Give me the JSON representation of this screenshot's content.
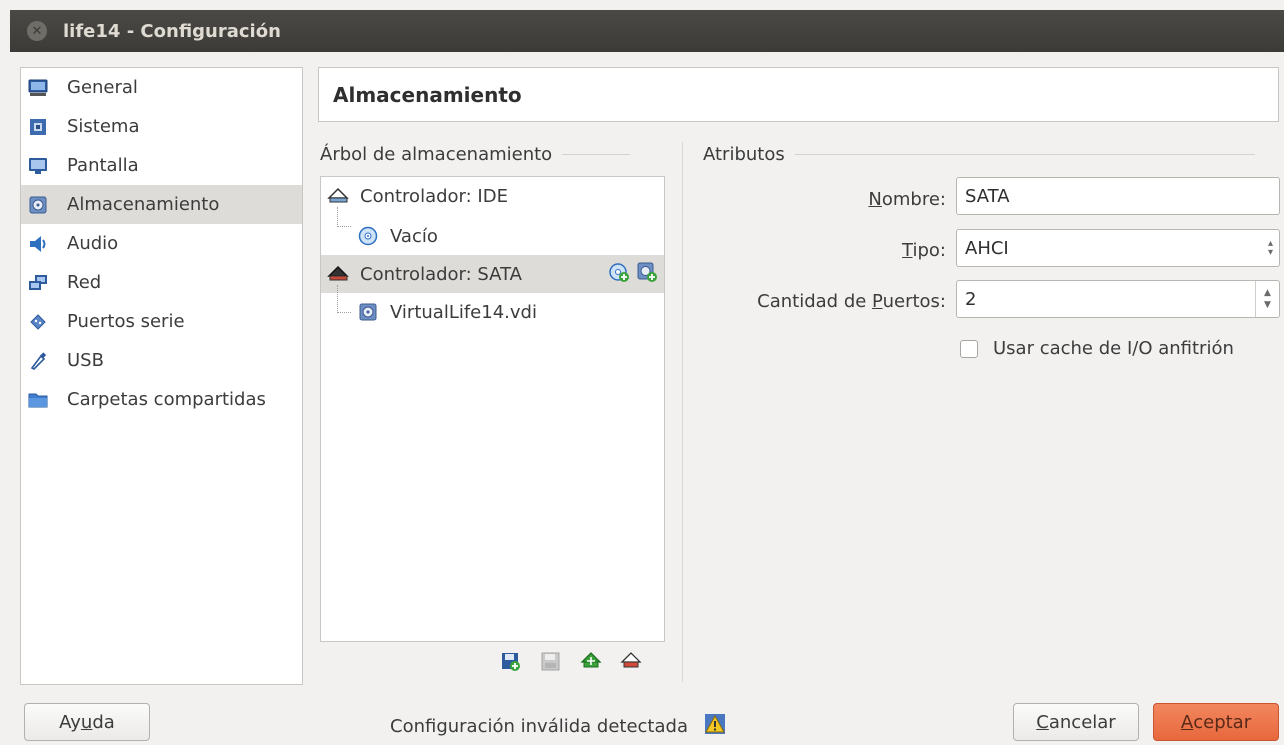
{
  "window": {
    "title": "life14 - Configuración",
    "close_glyph": "✕"
  },
  "sidebar": {
    "items": [
      {
        "label": "General",
        "icon": "monitor-icon"
      },
      {
        "label": "Sistema",
        "icon": "chip-icon"
      },
      {
        "label": "Pantalla",
        "icon": "display-icon"
      },
      {
        "label": "Almacenamiento",
        "icon": "hard-disk-icon",
        "selected": true
      },
      {
        "label": "Audio",
        "icon": "speaker-icon"
      },
      {
        "label": "Red",
        "icon": "network-icon"
      },
      {
        "label": "Puertos serie",
        "icon": "serial-port-icon"
      },
      {
        "label": "USB",
        "icon": "usb-icon"
      },
      {
        "label": "Carpetas compartidas",
        "icon": "folder-icon"
      }
    ]
  },
  "header": {
    "title": "Almacenamiento"
  },
  "storage_tree": {
    "title": "Árbol de almacenamiento",
    "nodes": [
      {
        "label": "Controlador: IDE",
        "icon": "ide-controller-icon"
      },
      {
        "label": "Vacío",
        "icon": "optical-disc-icon"
      },
      {
        "label": "Controlador: SATA",
        "icon": "sata-controller-icon",
        "selected": true
      },
      {
        "label": "VirtualLife14.vdi",
        "icon": "hard-disk-icon"
      }
    ],
    "toolbar": [
      "add-attachment-icon",
      "remove-attachment-icon",
      "add-controller-icon",
      "remove-controller-icon"
    ]
  },
  "attributes": {
    "title": "Atributos",
    "name_label_pre": "",
    "name_label_u": "N",
    "name_label_post": "ombre:",
    "name_value": "SATA",
    "type_label_u": "T",
    "type_label_post": "ipo:",
    "type_value": "AHCI",
    "ports_label_pre": "Cantidad de ",
    "ports_label_u": "P",
    "ports_label_post": "uertos:",
    "ports_value": "2",
    "cache_label": "Usar cache de I/O anfitrión",
    "cache_checked": false
  },
  "footer": {
    "help_pre": "Ay",
    "help_u": "u",
    "help_post": "da",
    "status": "Configuración inválida detectada",
    "status_icon": "warning-icon",
    "cancel_u": "C",
    "cancel_post": "ancelar",
    "ok_u": "A",
    "ok_post": "ceptar"
  },
  "colors": {
    "accent": "#e8683d",
    "selection": "#dedcd8",
    "titlebar": "#3c3b37"
  }
}
